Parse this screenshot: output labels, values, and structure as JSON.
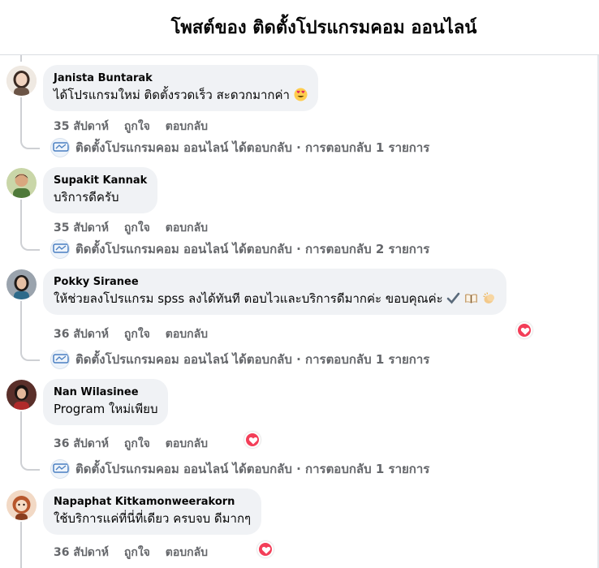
{
  "header": {
    "title": "โพสต์ของ ติดตั้งโปรแกรมคอม ออนไลน์"
  },
  "colors": {
    "reaction": "#f33e58",
    "bubble": "#f0f2f5",
    "muted": "#65676b",
    "line": "#ced0d4"
  },
  "comments": [
    {
      "author": "Janista Buntarak",
      "text": "ได้โปรแกรมใหม่ ติดตั้งรวดเร็ว สะดวกมากค่า",
      "emoji": "heart-eyes-emoji",
      "time": "35 สัปดาห์",
      "like": "ถูกใจ",
      "reply": "ตอบกลับ",
      "reply_summary": "ติดตั้งโปรแกรมคอม ออนไลน์ ได้ตอบกลับ · การตอบกลับ 1 รายการ"
    },
    {
      "author": "Supakit Kannak",
      "text": "บริการดีครับ",
      "time": "35 สัปดาห์",
      "like": "ถูกใจ",
      "reply": "ตอบกลับ",
      "reply_summary": "ติดตั้งโปรแกรมคอม ออนไลน์ ได้ตอบกลับ · การตอบกลับ 2 รายการ"
    },
    {
      "author": "Pokky Siranee",
      "text": "ให้ช่วยลงโปรแกรม spss ลงได้ทันที ตอบไวและบริการดีมากค่ะ ขอบคุณค่ะ",
      "emoji": "check-book-clap-emoji",
      "time": "36 สัปดาห์",
      "like": "ถูกใจ",
      "reply": "ตอบกลับ",
      "reaction": "love",
      "reply_summary": "ติดตั้งโปรแกรมคอม ออนไลน์ ได้ตอบกลับ · การตอบกลับ 1 รายการ"
    },
    {
      "author": "Nan Wilasinee",
      "text": "Program ใหม่เพียบ",
      "time": "36 สัปดาห์",
      "like": "ถูกใจ",
      "reply": "ตอบกลับ",
      "reaction": "love",
      "reply_summary": "ติดตั้งโปรแกรมคอม ออนไลน์ ได้ตอบกลับ · การตอบกลับ 1 รายการ"
    },
    {
      "author": "Napaphat Kitkamonweerakorn",
      "text": "ใช้บริการแค่ที่นี่ที่เดียว ครบจบ ดีมากๆ",
      "time": "36 สัปดาห์",
      "like": "ถูกใจ",
      "reply": "ตอบกลับ",
      "reaction": "love"
    }
  ]
}
